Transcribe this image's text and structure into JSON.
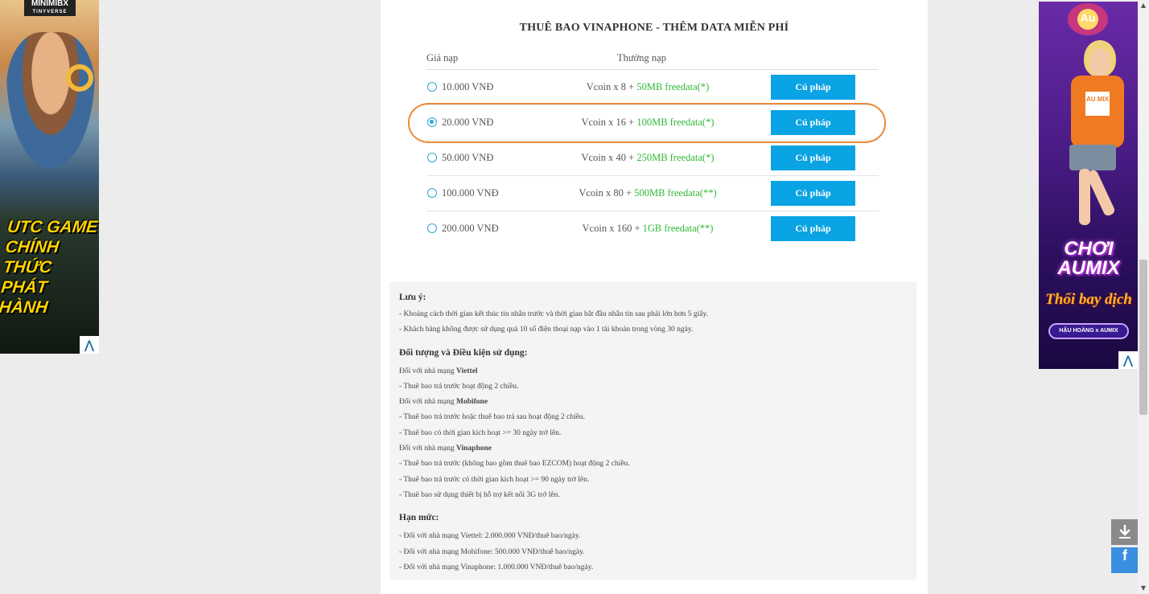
{
  "ads": {
    "left": {
      "brand_top": "MINIMIBX",
      "brand_sub": "TINYVERSE",
      "headline": "UTC GAME CHÍNH THỨC PHÁT HÀNH",
      "corner": "⋀"
    },
    "right": {
      "badge": "Au",
      "shirt": "AU MIX",
      "headline": "CHƠI AUMIX",
      "tagline": "Thổi bay dịch",
      "pill": "HẬU HOÀNG x AUMIX",
      "corner": "⋀"
    }
  },
  "panel": {
    "title": "THUÊ BAO VINAPHONE - THÊM DATA MIỄN PHÍ",
    "col_price": "Giá nạp",
    "col_reward": "Thưởng nạp",
    "rows": [
      {
        "price": "10.000 VNĐ",
        "vcoin": "Vcoin x 8 + ",
        "data": "50MB freedata(*)",
        "button": "Cú pháp",
        "selected": false
      },
      {
        "price": "20.000 VNĐ",
        "vcoin": "Vcoin x 16 + ",
        "data": "100MB freedata(*)",
        "button": "Cú pháp",
        "selected": true
      },
      {
        "price": "50.000 VNĐ",
        "vcoin": "Vcoin x 40 + ",
        "data": "250MB freedata(*)",
        "button": "Cú pháp",
        "selected": false
      },
      {
        "price": "100.000 VNĐ",
        "vcoin": "Vcoin x 80 + ",
        "data": "500MB freedata(**)",
        "button": "Cú pháp",
        "selected": false
      },
      {
        "price": "200.000 VNĐ",
        "vcoin": "Vcoin x 160 + ",
        "data": "1GB freedata(**)",
        "button": "Cú pháp",
        "selected": false
      }
    ]
  },
  "notes": {
    "luu_y_title": "Lưu ý:",
    "luu_y": [
      "- Khoảng cách thời gian kết thúc tin nhắn trước và thời gian bắt đầu nhắn tin sau phải lớn hơn 5 giây.",
      "- Khách hàng không được sử dụng quá 10 số điện thoại nạp vào 1 tài khoản trong vòng 30 ngày."
    ],
    "doi_tuong_title": "Đối tượng và Điều kiện sử dụng:",
    "viettel_prefix": "Đối với nhà mạng ",
    "viettel_name": "Viettel",
    "viettel_1": "- Thuê bao trả trước hoạt động 2 chiều.",
    "mobifone_prefix": "Đối với nhà mạng ",
    "mobifone_name": "Mobifone",
    "mobifone_1": "- Thuê bao trả trước hoặc thuê bao trả sau hoạt động 2 chiều.",
    "mobifone_2": "- Thuê bao có thời gian kích hoạt >= 30 ngày trở lên.",
    "vinaphone_prefix": "Đối với nhà mạng ",
    "vinaphone_name": "Vinaphone",
    "vinaphone_1": "- Thuê bao trả trước (không bao gồm thuê bao EZCOM) hoạt động 2 chiều.",
    "vinaphone_2": "- Thuê bao trả trước có thời gian kích hoạt >= 90 ngày trở lên.",
    "vinaphone_3": "- Thuê bao sử dụng thiết bị hỗ trợ kết nối 3G trở lên.",
    "han_muc_title": "Hạn mức:",
    "han_muc": [
      "- Đối với nhà mạng Viettel: 2.000.000 VNĐ/thuê bao/ngày.",
      "- Đối với nhà mạng Mobifone: 500.000 VNĐ/thuê bao/ngày.",
      "- Đối với nhà mạng Vinaphone: 1.000.000 VNĐ/thuê bao/ngày."
    ]
  },
  "floating": {
    "download_icon": "download-icon",
    "facebook_icon": "facebook-icon",
    "facebook_glyph": "f"
  },
  "colors": {
    "accent": "#0aa3e3",
    "freedata": "#2fb835",
    "highlight": "#e98a3a"
  }
}
